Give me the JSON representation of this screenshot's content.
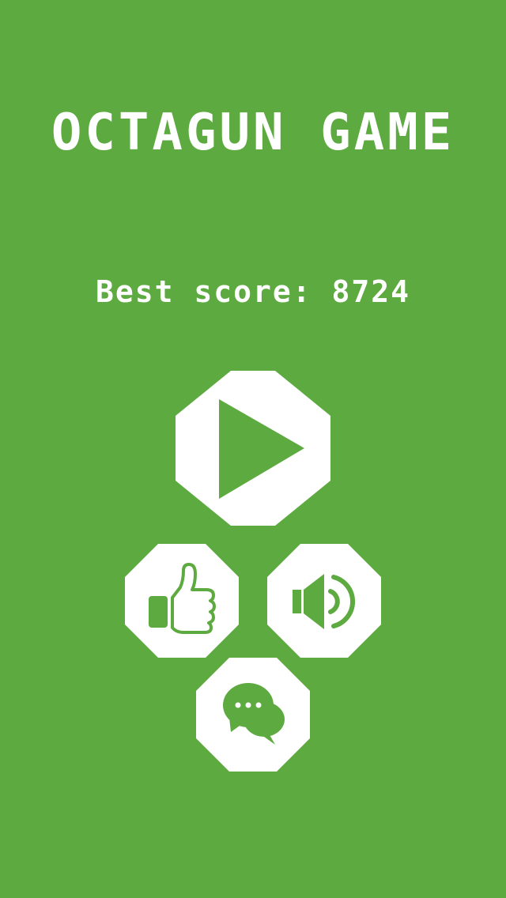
{
  "game": {
    "title": "OCTAGUN GAME",
    "best_score_label": "Best score: 8724",
    "best_score": 8724
  },
  "buttons": {
    "play": {
      "icon": "play-icon"
    },
    "like": {
      "icon": "thumbs-up-icon"
    },
    "sound": {
      "icon": "speaker-icon"
    },
    "chat": {
      "icon": "chat-bubbles-icon"
    }
  },
  "colors": {
    "background": "#5daa40",
    "foreground": "#ffffff"
  }
}
